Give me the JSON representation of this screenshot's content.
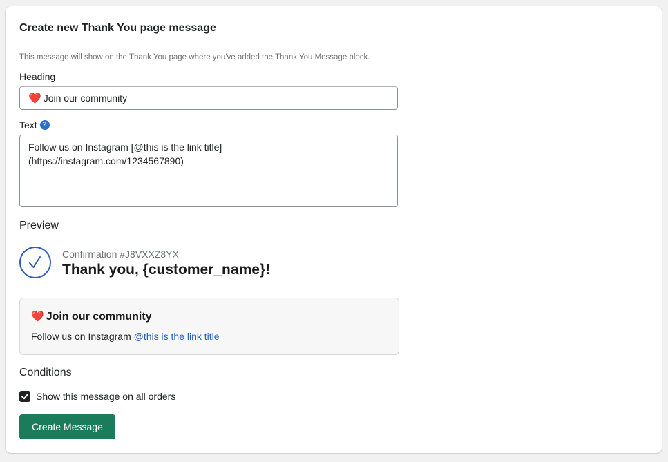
{
  "form": {
    "title": "Create new Thank You page message",
    "help_text": "This message will show on the Thank You page where you've added the Thank You Message block.",
    "heading_label": "Heading",
    "heading_value": "Join our community",
    "heading_emoji": "❤️",
    "text_label": "Text",
    "text_help_icon": "question-circle-icon",
    "text_line1": "Follow us on Instagram [@this is the link title]",
    "text_line2": "(https://instagram.com/1234567890)"
  },
  "preview": {
    "title": "Preview",
    "confirmation": "Confirmation #J8VXXZ8YX",
    "thank_you": "Thank you, {customer_name}!",
    "box_heading": "Join our community",
    "box_text_prefix": "Follow us on Instagram ",
    "box_link": "@this is the link title"
  },
  "conditions": {
    "title": "Conditions",
    "checkbox_label": "Show this message on all orders",
    "checkbox_checked": true
  },
  "actions": {
    "create_label": "Create Message"
  },
  "colors": {
    "primary_button": "#1a7c5a",
    "link": "#2c5fbd",
    "heart": "#e0223b"
  }
}
